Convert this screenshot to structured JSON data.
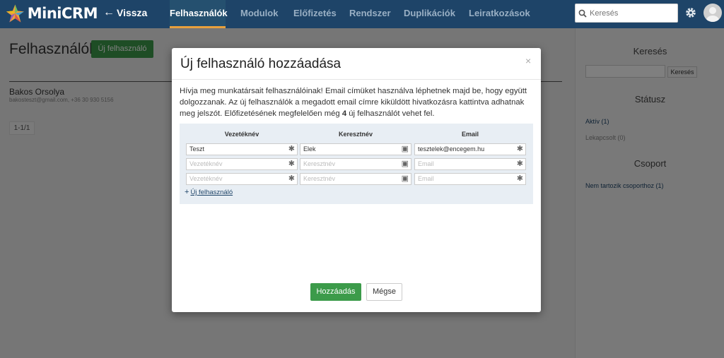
{
  "app": {
    "logo_text": "MiniCRM",
    "back_label": "Vissza"
  },
  "nav": {
    "tabs": [
      {
        "label": "Felhasználók",
        "active": true
      },
      {
        "label": "Modulok"
      },
      {
        "label": "Előfizetés"
      },
      {
        "label": "Rendszer"
      },
      {
        "label": "Duplikációk"
      },
      {
        "label": "Leiratkozások"
      }
    ],
    "search_placeholder": "Keresés"
  },
  "page": {
    "title": "Felhasználók",
    "new_user_button": "Új felhasználó",
    "contact": {
      "name": "Bakos Orsolya",
      "sub": "bakosteszt@gmail.com, +36 30 930 5156"
    },
    "pager": "1-1/1"
  },
  "sidebar": {
    "search_heading": "Keresés",
    "search_button": "Keresés",
    "status_heading": "Státusz",
    "status_items": [
      "Aktív (1)",
      "Lekapcsolt (0)"
    ],
    "group_heading": "Csoport",
    "group_items": [
      "Nem tartozik csoporthoz (1)"
    ]
  },
  "modal": {
    "title": "Új felhasználó hozzáadása",
    "close": "×",
    "text_before": "Hívja meg munkatársait felhasználóinak! Email címüket használva léphetnek majd be, hogy együtt dolgozzanak. Az új felhasználók a megadott email címre kiküldött hivatkozásra kattintva adhatnak meg jelszót. Előfizetésének megfelelően még ",
    "text_count": "4",
    "text_after": " új felhasználót vehet fel.",
    "columns": [
      "Vezetéknév",
      "Keresztnév",
      "Email"
    ],
    "rows": [
      {
        "last": "Teszt",
        "first": "Elek",
        "email": "tesztelek@encegem.hu"
      },
      {
        "last": "",
        "first": "",
        "email": ""
      },
      {
        "last": "",
        "first": "",
        "email": ""
      }
    ],
    "placeholders": {
      "last": "Vezetéknév",
      "first": "Keresztnév",
      "email": "Email"
    },
    "add_row": "Új felhasználó",
    "submit": "Hozzáadás",
    "cancel": "Mégse"
  },
  "colors": {
    "nav_bg": "#1e4468",
    "accent": "#e8a13c",
    "green": "#3c9b4a"
  }
}
